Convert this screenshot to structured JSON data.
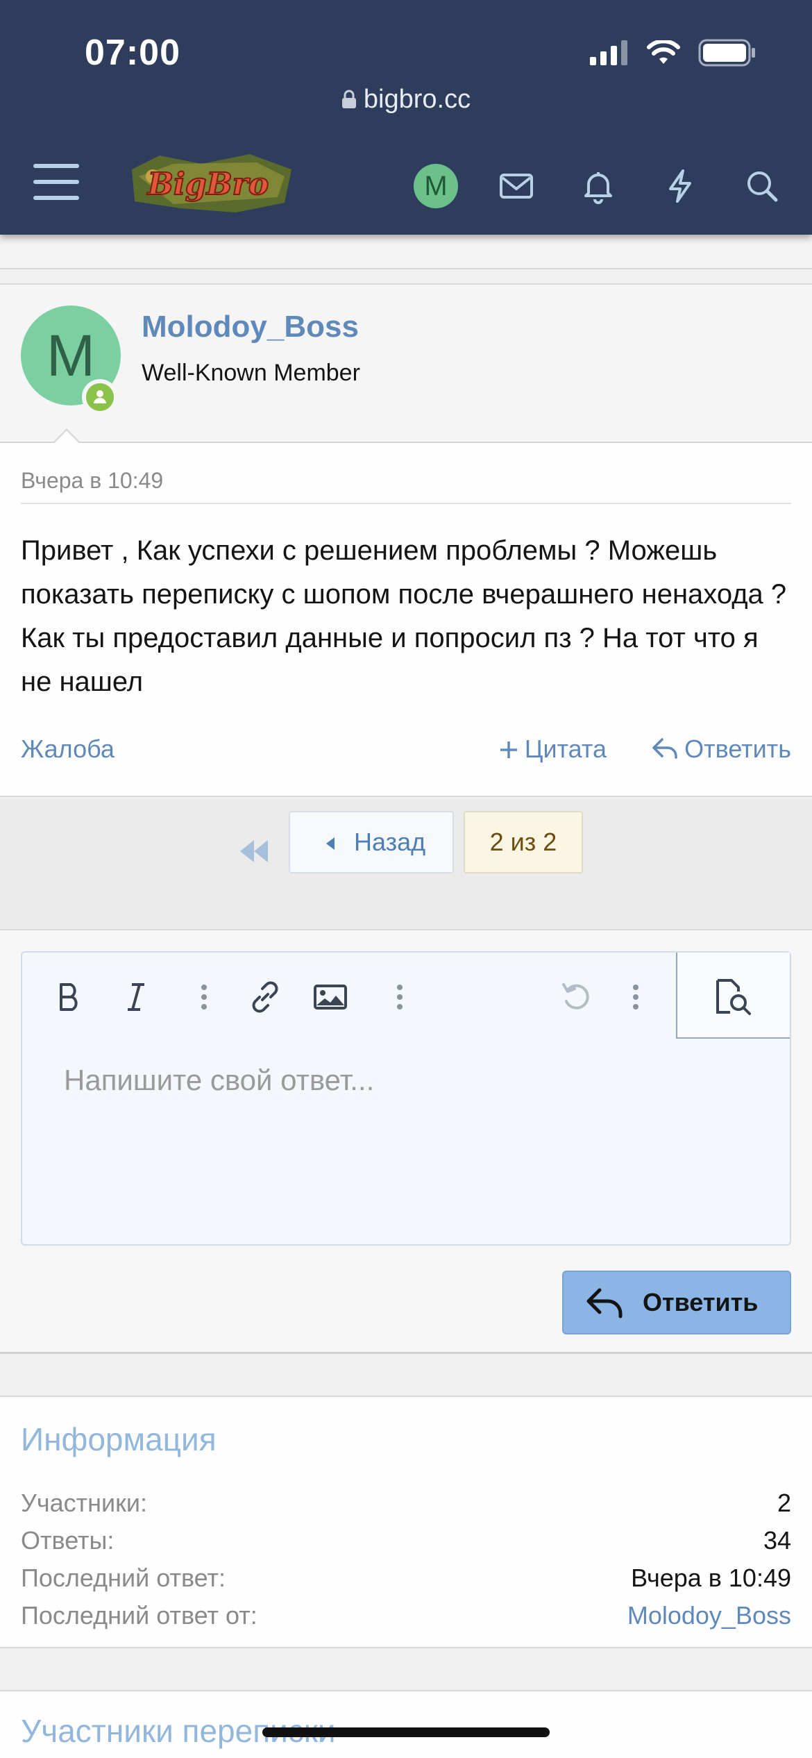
{
  "status_bar": {
    "time": "07:00"
  },
  "browser": {
    "url": "bigbro.cc"
  },
  "nav": {
    "logo_text": "BigBro",
    "avatar_letter": "M"
  },
  "post": {
    "avatar_letter": "M",
    "username": "Molodoy_Boss",
    "user_title": "Well-Known Member",
    "date": "Вчера в 10:49",
    "text": "Привет , Как успехи с решением проблемы ? Можешь показать переписку с шопом после вчерашнего ненахода ? Как ты предоставил данные и попросил пз ? На тот что я не нашел",
    "actions": {
      "report": "Жалоба",
      "quote": "Цитата",
      "reply": "Ответить"
    }
  },
  "pagination": {
    "prev_label": "Назад",
    "current": "2 из 2"
  },
  "editor": {
    "placeholder": "Напишите свой ответ...",
    "submit_label": "Ответить"
  },
  "info": {
    "title": "Информация",
    "rows": [
      {
        "label": "Участники:",
        "value": "2"
      },
      {
        "label": "Ответы:",
        "value": "34"
      },
      {
        "label": "Последний ответ:",
        "value": "Вчера в 10:49"
      },
      {
        "label": "Последний ответ от:",
        "value": "Molodoy_Boss"
      }
    ]
  },
  "members": {
    "title": "Участники переписки"
  },
  "colors": {
    "header_bg": "#2e3d5c",
    "link": "#5f89b8",
    "accent_button": "#8ab5e4",
    "online": "#8ac24a"
  }
}
